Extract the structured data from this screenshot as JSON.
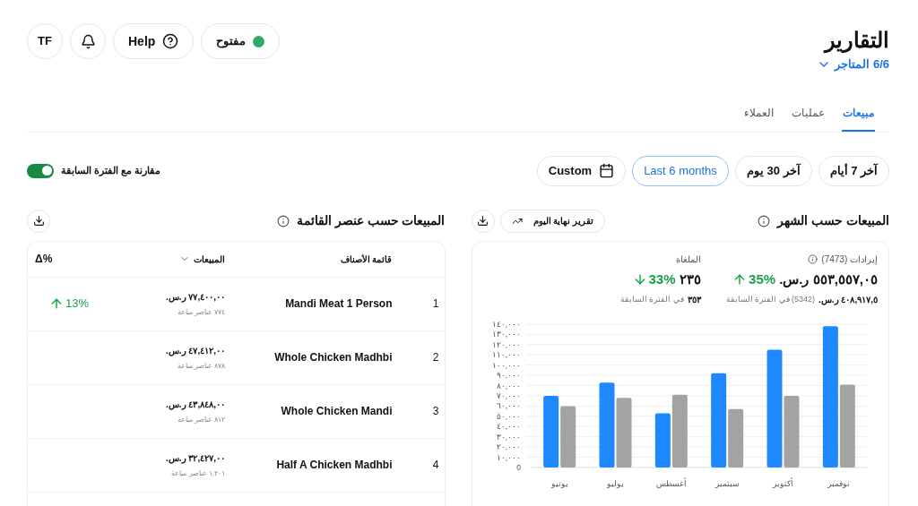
{
  "header": {
    "title": "التقارير",
    "stores": "6/6 المتاجر",
    "status": {
      "label": "مفتوح",
      "open": true
    },
    "help": "Help",
    "avatar": "TF"
  },
  "tabs": [
    {
      "label": "مبيعات",
      "selected": true
    },
    {
      "label": "عمليات",
      "selected": false
    },
    {
      "label": "العملاء",
      "selected": false
    }
  ],
  "date_ranges": [
    {
      "label": "آخر 7 أيام",
      "selected": false,
      "kind": "preset"
    },
    {
      "label": "آخر 30 يوم",
      "selected": false,
      "kind": "preset"
    },
    {
      "label": "Last 6 months",
      "selected": true,
      "kind": "preset"
    },
    {
      "label": "Custom",
      "selected": false,
      "kind": "custom"
    }
  ],
  "compare": {
    "label": "مقارنة مع الفترة السابقة",
    "on": true
  },
  "monthly": {
    "title": "المبيعات حسب الشهر",
    "eod_report": "تقرير نهاية اليوم",
    "revenue": {
      "label": "إيرادات (7473)",
      "value": "٥٥٣,٥٥٧,٠٥ ر.س.",
      "change": "35%",
      "up": true,
      "previous": "٤٠٨,٩١٧,٥ ر.س.",
      "previous_note": "(5342) في الفترة السابقة"
    },
    "cancelled": {
      "label": "الملغاة",
      "value": "٢٣٥",
      "change": "33%",
      "up": false,
      "previous": "٣٥٣",
      "previous_note": "في الفترة السابقة"
    },
    "chart_data": {
      "type": "bar",
      "categories": [
        "يونيو",
        "يوليو",
        "أغسطس",
        "سبتمبر",
        "أكتوبر",
        "نوفمبر"
      ],
      "series": [
        {
          "color": "#1e88ff",
          "values": [
            70000,
            83000,
            53000,
            92000,
            115000,
            138000
          ]
        },
        {
          "color": "#a3a3a3",
          "values": [
            60000,
            68000,
            71000,
            57000,
            70000,
            81000
          ]
        }
      ],
      "ylim": [
        0,
        140000
      ],
      "grid": true,
      "yticks": [
        {
          "value": 0,
          "label": "0"
        },
        {
          "value": 10000,
          "label": "١٠,٠٠٠"
        },
        {
          "value": 20000,
          "label": "٢٠,٠٠٠"
        },
        {
          "value": 30000,
          "label": "٣٠,٠٠٠"
        },
        {
          "value": 40000,
          "label": "٤٠,٠٠٠"
        },
        {
          "value": 50000,
          "label": "٥٠,٠٠٠"
        },
        {
          "value": 60000,
          "label": "٦٠,٠٠٠"
        },
        {
          "value": 70000,
          "label": "٧٠,٠٠٠"
        },
        {
          "value": 80000,
          "label": "٨٠,٠٠٠"
        },
        {
          "value": 90000,
          "label": "٩٠,٠٠٠"
        },
        {
          "value": 100000,
          "label": "١٠٠,٠٠٠"
        },
        {
          "value": 110000,
          "label": "١١٠,٠٠٠"
        },
        {
          "value": 120000,
          "label": "١٢٠,٠٠٠"
        },
        {
          "value": 130000,
          "label": "١٣٠,٠٠٠"
        },
        {
          "value": 140000,
          "label": "١٤٠,٠٠٠"
        }
      ]
    }
  },
  "items": {
    "title": "المبيعات حسب عنصر القائمة",
    "columns": [
      {
        "label": "قائمة الأصناف",
        "sorted": false
      },
      {
        "label": "المبيعات",
        "sorted": true
      },
      {
        "label": "Δ%",
        "sorted": false
      }
    ],
    "rows": [
      {
        "rank": "1",
        "name": "Mandi Meat 1 Person",
        "sales": "٧٧,٤٠٠,٠٠ ر.س.",
        "sold": "٧٧٤ عناصر مباعة",
        "delta": {
          "value": "13%",
          "up": true
        }
      },
      {
        "rank": "2",
        "name": "Whole Chicken Madhbi",
        "sales": "٤٧,٤١٢,٠٠ ر.س.",
        "sold": "٨٧٨ عناصر مباعة"
      },
      {
        "rank": "3",
        "name": "Whole Chicken Mandi",
        "sales": "٤٣,٨٤٨,٠٠ ر.س.",
        "sold": "٨١٢ عناصر مباعة"
      },
      {
        "rank": "4",
        "name": "Half A Chicken Madhbi",
        "sales": "٣٢,٤٢٧,٠٠ ر.س.",
        "sold": "١,٢٠١ عناصر مباعة"
      }
    ]
  }
}
